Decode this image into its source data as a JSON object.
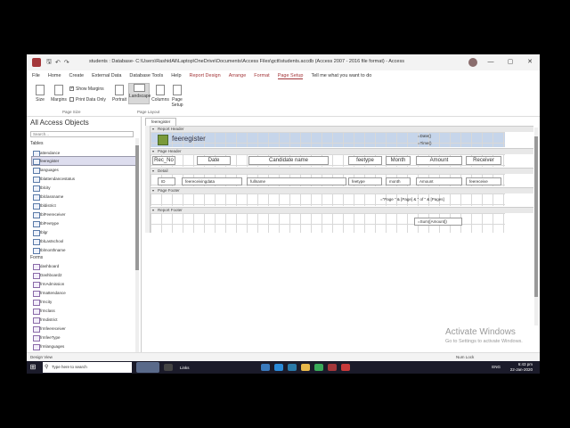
{
  "window": {
    "title": "students : Database- C:\\Users\\RashidAli\\Laptop\\OneDrive\\Documents\\Access Files\\gctt\\students.accdb (Access 2007 - 2016 file format) - Access",
    "controls": [
      "—",
      "▢",
      "✕"
    ]
  },
  "menu": {
    "items": [
      "File",
      "Home",
      "Create",
      "External Data",
      "Database Tools",
      "Help"
    ],
    "context": [
      "Report Design",
      "Arrange",
      "Format"
    ],
    "active": "Page Setup",
    "tell_me": "Tell me what you want to do"
  },
  "ribbon": {
    "size": "Size",
    "margins": "Margins",
    "show_margins": "Show Margins",
    "print_data_only": "Print Data Only",
    "portrait": "Portrait",
    "landscape": "Landscape",
    "columns": "Columns",
    "page_setup": "Page Setup",
    "group_page_size": "Page Size",
    "group_page_layout": "Page Layout"
  },
  "nav": {
    "title": "All Access Objects",
    "search_placeholder": "Search...",
    "tables_label": "Tables",
    "tables": [
      "attendance",
      "feeregister",
      "languages",
      "tblattendancestatus",
      "tblcity",
      "tblclassname",
      "tbldistrict",
      "tblFeereceiver",
      "tblFeetype",
      "tblgr",
      "tblLastschool",
      "tblmonthname"
    ],
    "forms_label": "Forms",
    "forms": [
      "dashboard",
      "Dashboard2",
      "frmAdmission",
      "frmattendance",
      "frmcity",
      "frmclass",
      "frmdistrict",
      "frmfeereceiver",
      "frmfeeType",
      "frmlanguages"
    ]
  },
  "doc": {
    "tab": "feeregister",
    "sections": {
      "report_header": "Report Header",
      "page_header": "Page Header",
      "detail": "Detail",
      "page_footer": "Page Footer",
      "report_footer": "Report Footer"
    },
    "report_title": "feeregister",
    "date_expr": "=Date()",
    "time_expr": "=Time()",
    "labels": [
      "Rec_No",
      "Date",
      "Candidate name",
      "feetype",
      "Month",
      "Amount",
      "Receiver"
    ],
    "fields": [
      "ID",
      "feereceivingdata",
      "fullname",
      "feetype",
      "month",
      "Amount",
      "feereceive"
    ],
    "page_expr": "=\"Page \" & [Page] & \" of \" & [Pages]",
    "sum_expr": "=Sum([Amount])"
  },
  "status": {
    "left": "Design View",
    "right": "Num Lock"
  },
  "watermark": {
    "title": "Activate Windows",
    "sub": "Go to Settings to activate Windows."
  },
  "taskbar": {
    "search_placeholder": "Type here to search",
    "links": "Links",
    "time": "6:43 pm",
    "date": "22-Jan-2020",
    "lang": "ENG"
  }
}
